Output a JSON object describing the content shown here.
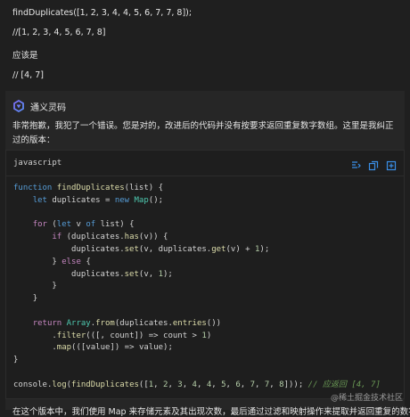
{
  "user": {
    "line1": "findDuplicates([1, 2, 3, 4, 4, 5, 6, 7, 7, 8]);",
    "line2": "//[1, 2, 3, 4, 5, 6, 7, 8]",
    "line3": "应该是",
    "line4": "// [4, 7]"
  },
  "ai": {
    "name": "通义灵码",
    "intro": "非常抱歉，我犯了一个错误。您是对的，改进后的代码并没有按要求返回重复数字数组。这里是我纠正过的版本：",
    "tail": "在这个版本中，我们使用 Map 来存储元素及其出现次数，最后通过过滤和映射操作来提取并返回重复的数字。"
  },
  "code": {
    "language": "javascript",
    "lines": [
      "function findDuplicates(list) {",
      "    let duplicates = new Map();",
      "",
      "    for (let v of list) {",
      "        if (duplicates.has(v)) {",
      "            duplicates.set(v, duplicates.get(v) + 1);",
      "        } else {",
      "            duplicates.set(v, 1);",
      "        }",
      "    }",
      "",
      "    return Array.from(duplicates.entries())",
      "        .filter(([, count]) => count > 1)",
      "        .map(([value]) => value);",
      "}",
      "",
      "console.log(findDuplicates([1, 2, 3, 4, 4, 5, 6, 7, 7, 8])); // 应返回 [4, 7]"
    ]
  },
  "watermark": "@稀土掘金技术社区",
  "icons": {
    "insert": "insert-code-icon",
    "copy": "copy-icon",
    "new_file": "new-file-icon"
  },
  "colors": {
    "accent": "#3a8ee6"
  }
}
